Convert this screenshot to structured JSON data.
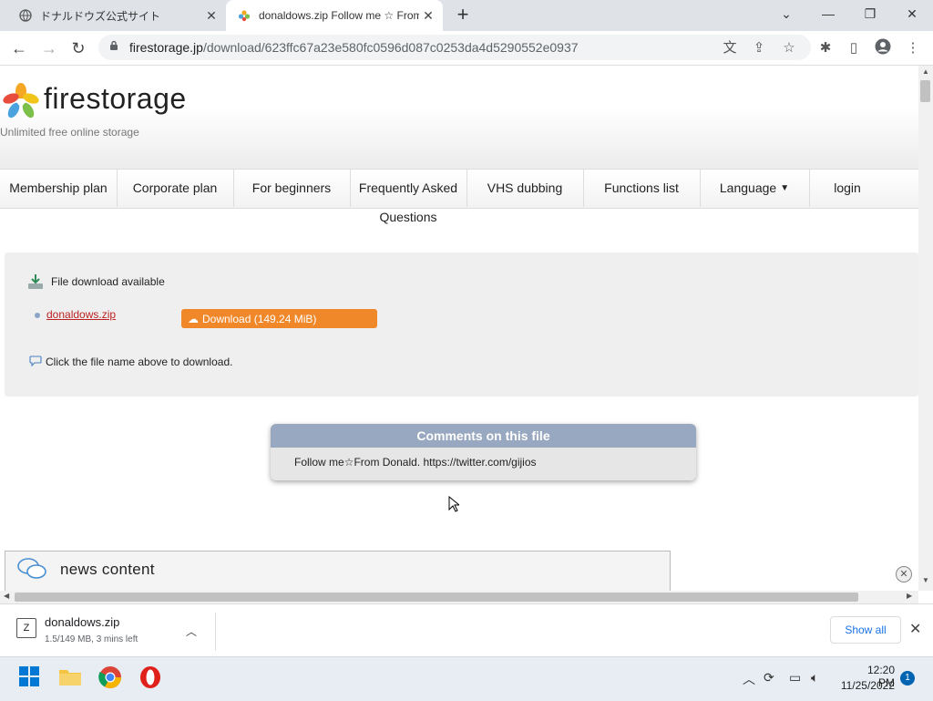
{
  "browser": {
    "tabs": [
      {
        "title": "ドナルドウズ公式サイト",
        "active": false
      },
      {
        "title": "donaldows.zip Follow me ☆ From",
        "active": true
      }
    ],
    "url_host": "firestorage.jp",
    "url_path": "/download/623ffc67a23e580fc0596d087c0253da4d5290552e0937"
  },
  "site": {
    "logo": "firestorage",
    "tagline": "Unlimited free online storage",
    "nav": {
      "membership": "Membership plan",
      "corporate": "Corporate plan",
      "beginners": "For beginners",
      "faq_line1": "Frequently Asked",
      "faq_line2": "Questions",
      "vhs": "VHS dubbing",
      "functions": "Functions list",
      "language": "Language",
      "login": "login"
    }
  },
  "download": {
    "status": "File download available",
    "filename": "donaldows.zip",
    "button_label": "Download (149.24 MiB)",
    "hint": "Click the file name above to download."
  },
  "comments": {
    "title": "Comments on this file",
    "body": "Follow me☆From Donald. https://twitter.com/gijios"
  },
  "news": {
    "title": "news content"
  },
  "shelf": {
    "filename": "donaldows.zip",
    "status": "1.5/149 MB, 3 mins left",
    "show_all": "Show all"
  },
  "taskbar": {
    "time": "12:20 PM",
    "date": "11/25/2022",
    "notifications": "1"
  },
  "colors": {
    "accent_button": "#f0882a",
    "comments_header": "#98a8c0",
    "filename_link": "#b22222"
  }
}
